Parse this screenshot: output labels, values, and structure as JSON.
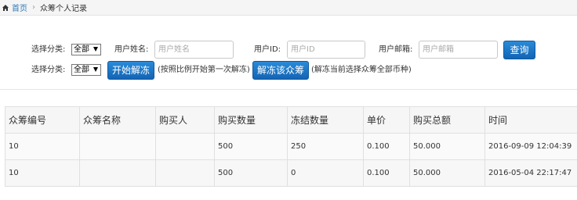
{
  "breadcrumb": {
    "home": "首页",
    "separator": "›",
    "current": "众筹个人记录"
  },
  "filters": {
    "row1": {
      "category_label": "选择分类:",
      "category_value": "全部",
      "name_label": "用户姓名:",
      "name_placeholder": "用户姓名",
      "id_label": "用户ID:",
      "id_placeholder": "用户ID",
      "email_label": "用户邮箱:",
      "email_placeholder": "用户邮箱",
      "search_button": "查询"
    },
    "row2": {
      "category_label": "选择分类:",
      "category_value": "全部",
      "unfreeze_button": "开始解冻",
      "unfreeze_hint": "(按照比例开始第一次解冻)",
      "unfreeze_all_button": "解冻该众筹",
      "unfreeze_all_hint": "(解冻当前选择众筹全部币种)"
    }
  },
  "table": {
    "columns": [
      "众筹编号",
      "众筹名称",
      "购买人",
      "购买数量",
      "冻结数量",
      "单价",
      "购买总额",
      "时间"
    ],
    "rows": [
      [
        "10",
        "",
        "",
        "500",
        "250",
        "0.100",
        "50.000",
        "2016-09-09 12:04:39"
      ],
      [
        "10",
        "",
        "",
        "500",
        "0",
        "0.100",
        "50.000",
        "2016-05-04 22:17:47"
      ]
    ]
  },
  "colors": {
    "link": "#2f7ab8",
    "button": "#1a72c4"
  }
}
